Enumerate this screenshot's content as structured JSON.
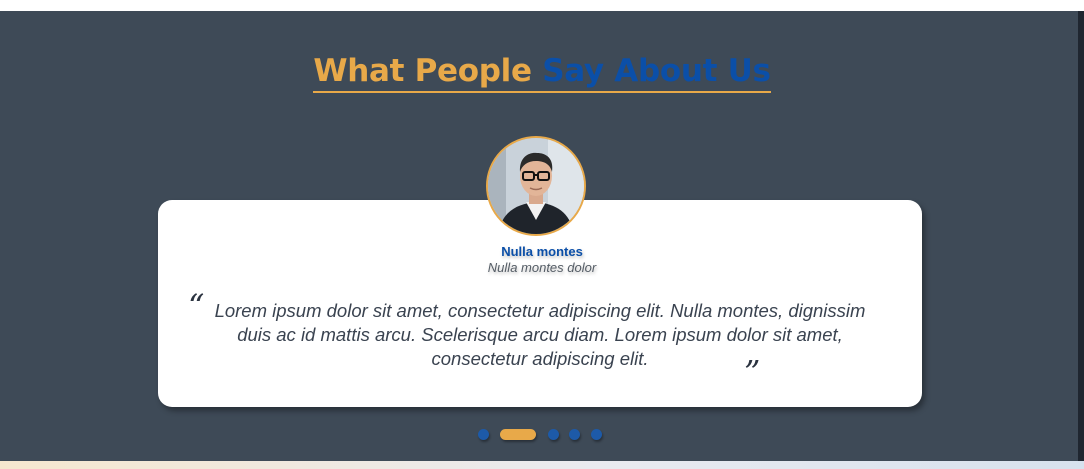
{
  "testimonials": {
    "heading_part1": "What People",
    "heading_part2": "Say About Us",
    "name": "Nulla montes",
    "role": "Nulla montes dolor",
    "quote": "Lorem ipsum dolor sit amet, consectetur adipiscing elit. Nulla montes, dignissim duis ac id mattis arcu. Scelerisque  arcu diam. Lorem ipsum dolor sit amet, consectetur adipiscing elit.",
    "quote_open_mark": "“",
    "quote_close_mark": "”",
    "pagination": {
      "count": 5,
      "active_index": 1
    }
  },
  "colors": {
    "section_bg": "#3e4a57",
    "accent": "#e8a949",
    "brand_blue": "#0b4fa8",
    "card_bg": "#ffffff"
  },
  "icons": {
    "avatar": "person-photo-icon"
  }
}
